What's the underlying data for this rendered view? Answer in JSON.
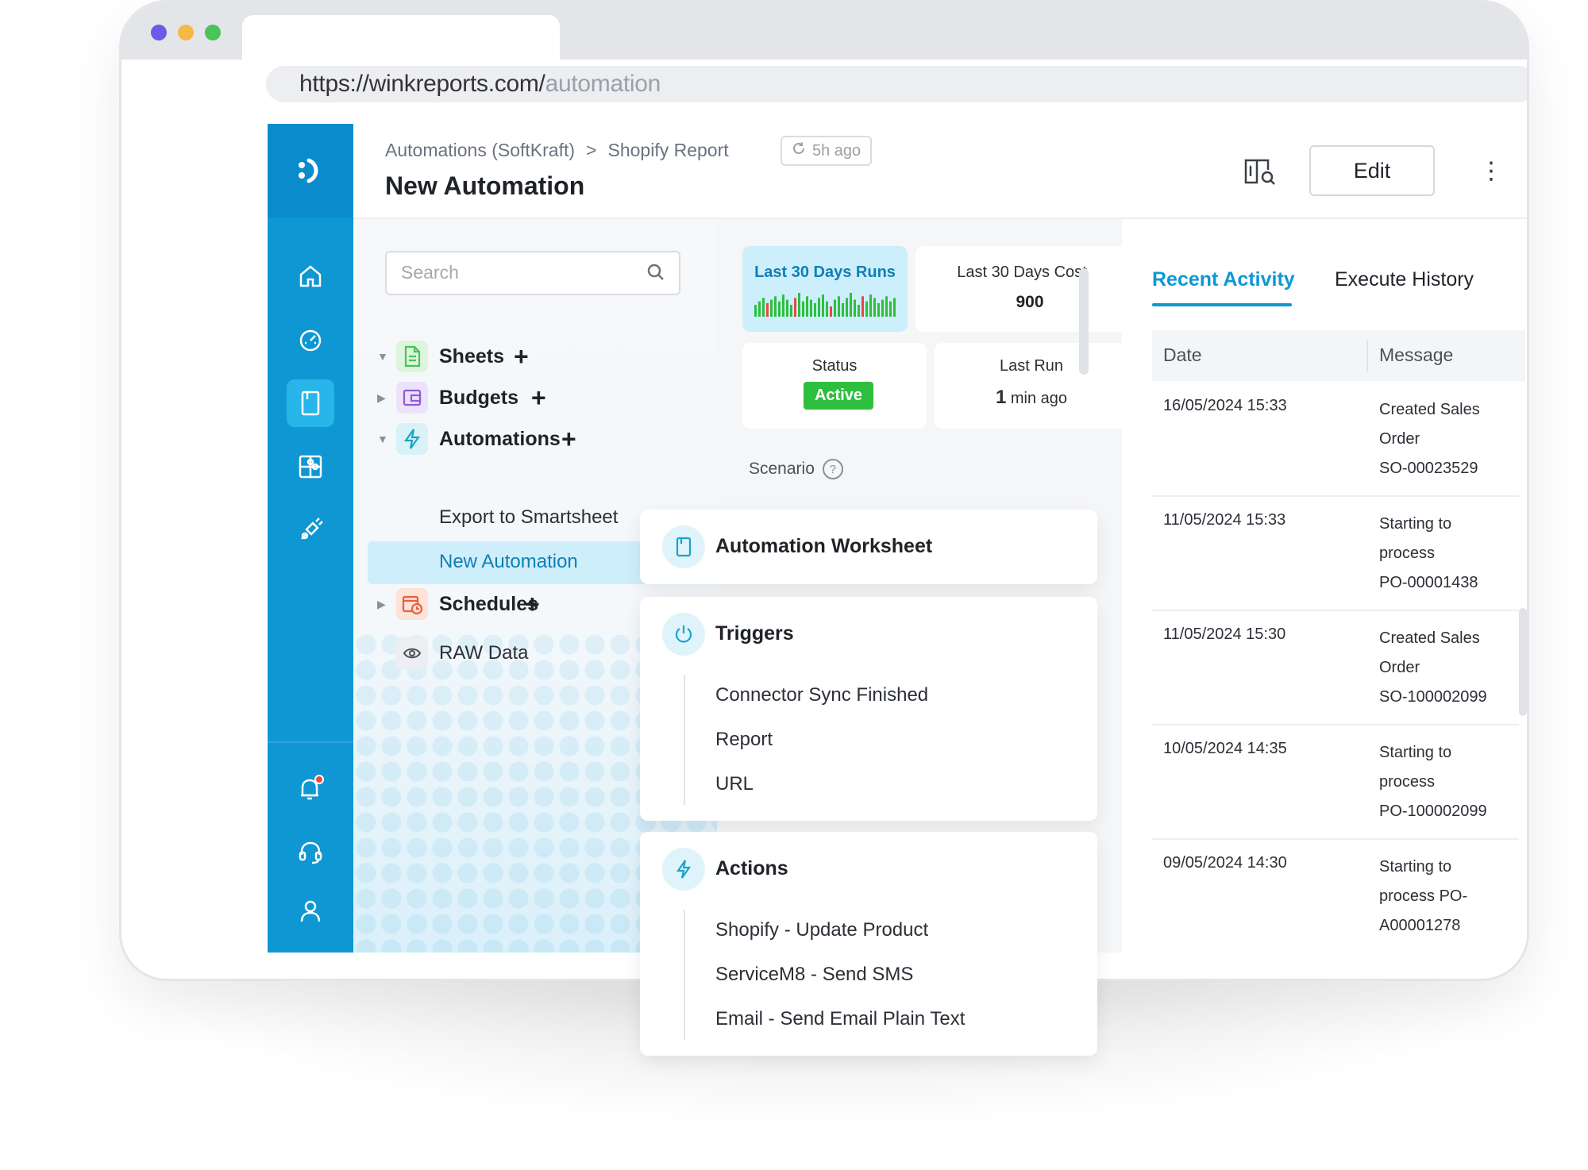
{
  "browser": {
    "url_base": "https://winkreports.com/",
    "url_path": "automation",
    "traffic_colors": [
      "#6a5ce8",
      "#f5b946",
      "#49c35a"
    ]
  },
  "header": {
    "breadcrumb_parent": "Automations (SoftKraft)",
    "breadcrumb_separator": ">",
    "breadcrumb_current": "Shopify Report",
    "updated_ago": "5h ago",
    "page_title": "New Automation",
    "edit_label": "Edit",
    "more_label": "⋮"
  },
  "sidebar_rail": {
    "accent": "#0e97d3",
    "icons": [
      "logo-icon",
      "home-icon",
      "dashboard-gauge-icon",
      "worksheet-icon",
      "puzzle-icon",
      "plug-icon",
      "bell-icon",
      "headset-icon",
      "user-icon"
    ],
    "notification_dot_color": "#f0483e"
  },
  "tree": {
    "search_placeholder": "Search",
    "groups": [
      {
        "label": "Sheets",
        "plus": "+",
        "icon": "sheet-icon",
        "color": "#49c35a"
      },
      {
        "label": "Budgets",
        "plus": "+",
        "icon": "wallet-icon",
        "color": "#8e5bd8"
      },
      {
        "label": "Automations",
        "plus": "+",
        "icon": "lightning-icon",
        "color": "#1aa3c7"
      },
      {
        "label": "Schedules",
        "plus": "+",
        "icon": "calendar-clock-icon",
        "color": "#e8603c"
      }
    ],
    "automation_items": [
      "Export to Smartsheet",
      "New Automation"
    ],
    "raw_data_label": "RAW Data"
  },
  "stats": {
    "runs_label": "Last 30 Days Runs",
    "runs_bars": [
      14,
      18,
      22,
      16,
      20,
      24,
      18,
      26,
      20,
      14,
      22,
      28,
      18,
      24,
      20,
      16,
      22,
      26,
      18,
      12,
      20,
      24,
      16,
      22,
      28,
      20,
      14,
      24,
      18,
      26,
      22,
      16,
      20,
      24,
      18,
      22
    ],
    "runs_fail_indices": [
      3,
      10,
      19,
      27
    ],
    "cost_label": "Last 30 Days Cost",
    "cost_value": "900",
    "status_label": "Status",
    "status_value": "Active",
    "last_run_label": "Last Run",
    "last_run_value": "1",
    "last_run_unit": "min ago"
  },
  "scenario": {
    "label": "Scenario",
    "help": "?",
    "worksheet_title": "Automation Worksheet",
    "triggers_title": "Triggers",
    "triggers": [
      "Connector Sync Finished",
      "Report",
      "URL"
    ],
    "actions_title": "Actions",
    "actions": [
      "Shopify - Update Product",
      "ServiceM8 - Send SMS",
      "Email - Send Email Plain Text"
    ]
  },
  "activity": {
    "tab_recent": "Recent Activity",
    "tab_history": "Execute History",
    "col_date": "Date",
    "col_message": "Message",
    "rows": [
      {
        "date": "16/05/2024 15:33",
        "message": [
          "Created Sales",
          "Order",
          "SO-00023529"
        ]
      },
      {
        "date": "11/05/2024 15:33",
        "message": [
          "Starting to",
          "process",
          "PO-00001438"
        ]
      },
      {
        "date": "11/05/2024 15:30",
        "message": [
          "Created Sales",
          "Order",
          "SO-100002099"
        ]
      },
      {
        "date": "10/05/2024 14:35",
        "message": [
          "Starting to",
          "process",
          "PO-100002099"
        ]
      },
      {
        "date": "09/05/2024 14:30",
        "message": [
          "Starting to",
          "process PO-",
          "A00001278"
        ]
      }
    ]
  }
}
